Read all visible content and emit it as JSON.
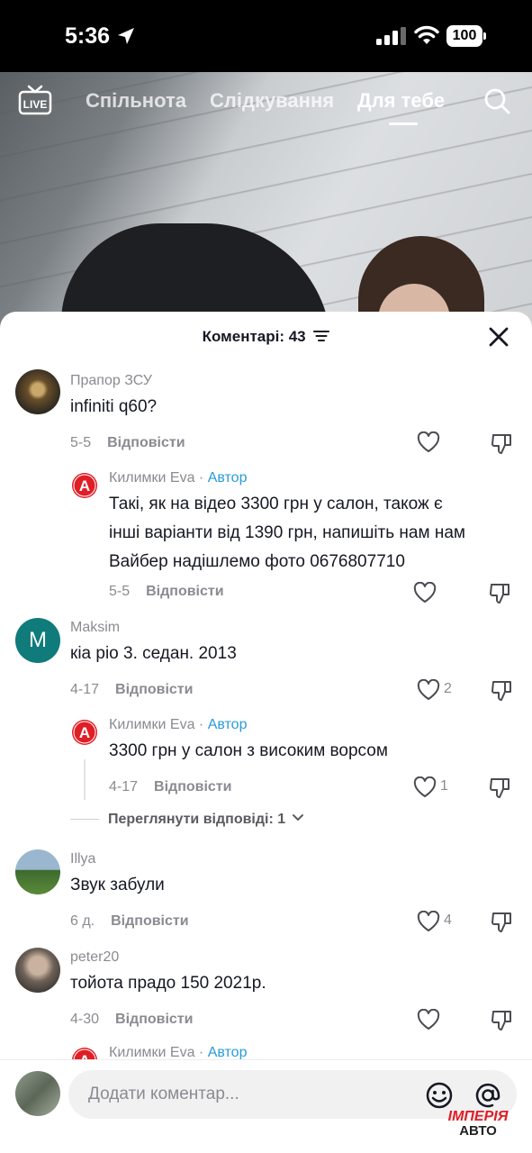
{
  "status_bar": {
    "time": "5:36",
    "battery": "100"
  },
  "top_nav": {
    "live_label": "LIVE",
    "tabs": [
      {
        "label": "Спільнота",
        "active": false
      },
      {
        "label": "Слідкування",
        "active": false
      },
      {
        "label": "Для тебе",
        "active": true
      }
    ]
  },
  "comments_sheet": {
    "title": "Коментарі: 43",
    "comments": [
      {
        "username": "Прапор ЗСУ",
        "text": "infiniti q60?",
        "date": "5-5",
        "reply_label": "Відповісти",
        "likes": ""
      },
      {
        "username": "Килимки Eva",
        "separator": " · ",
        "author_tag": "Автор",
        "avatar_letter": "A",
        "text_lines": [
          "Такі, як на відео 3300 грн у салон, також є",
          "інші варіанти від 1390 грн, напишіть нам нам",
          "Вайбер надішлемо фото 0676807710"
        ],
        "date": "5-5",
        "reply_label": "Відповісти",
        "likes": ""
      },
      {
        "username": "Maksim",
        "avatar_letter": "M",
        "text": "кіа ріо 3. седан. 2013",
        "date": "4-17",
        "reply_label": "Відповісти",
        "likes": "2"
      },
      {
        "username": "Килимки Eva",
        "separator": " · ",
        "author_tag": "Автор",
        "avatar_letter": "A",
        "text": "3300 грн у салон з високим ворсом",
        "date": "4-17",
        "reply_label": "Відповісти",
        "likes": "1"
      },
      {
        "username": "Illya",
        "text": "Звук забули",
        "date": "6 д.",
        "reply_label": "Відповісти",
        "likes": "4"
      },
      {
        "username": "peter20",
        "text": "тойота прадо 150 2021р.",
        "date": "4-30",
        "reply_label": "Відповісти",
        "likes": ""
      },
      {
        "username": "Килимки Eva",
        "separator": " · ",
        "author_tag": "Автор",
        "avatar_letter": "A"
      }
    ],
    "view_replies_label": "Переглянути відповіді: 1"
  },
  "input": {
    "placeholder": "Додати коментар..."
  },
  "watermark": {
    "line1": "ІМПЕРІЯ",
    "line2": "АВТО"
  },
  "colors": {
    "author_accent": "#2a9bd8",
    "brand_red": "#e11d26",
    "maksim_avatar": "#0f7b7b"
  }
}
